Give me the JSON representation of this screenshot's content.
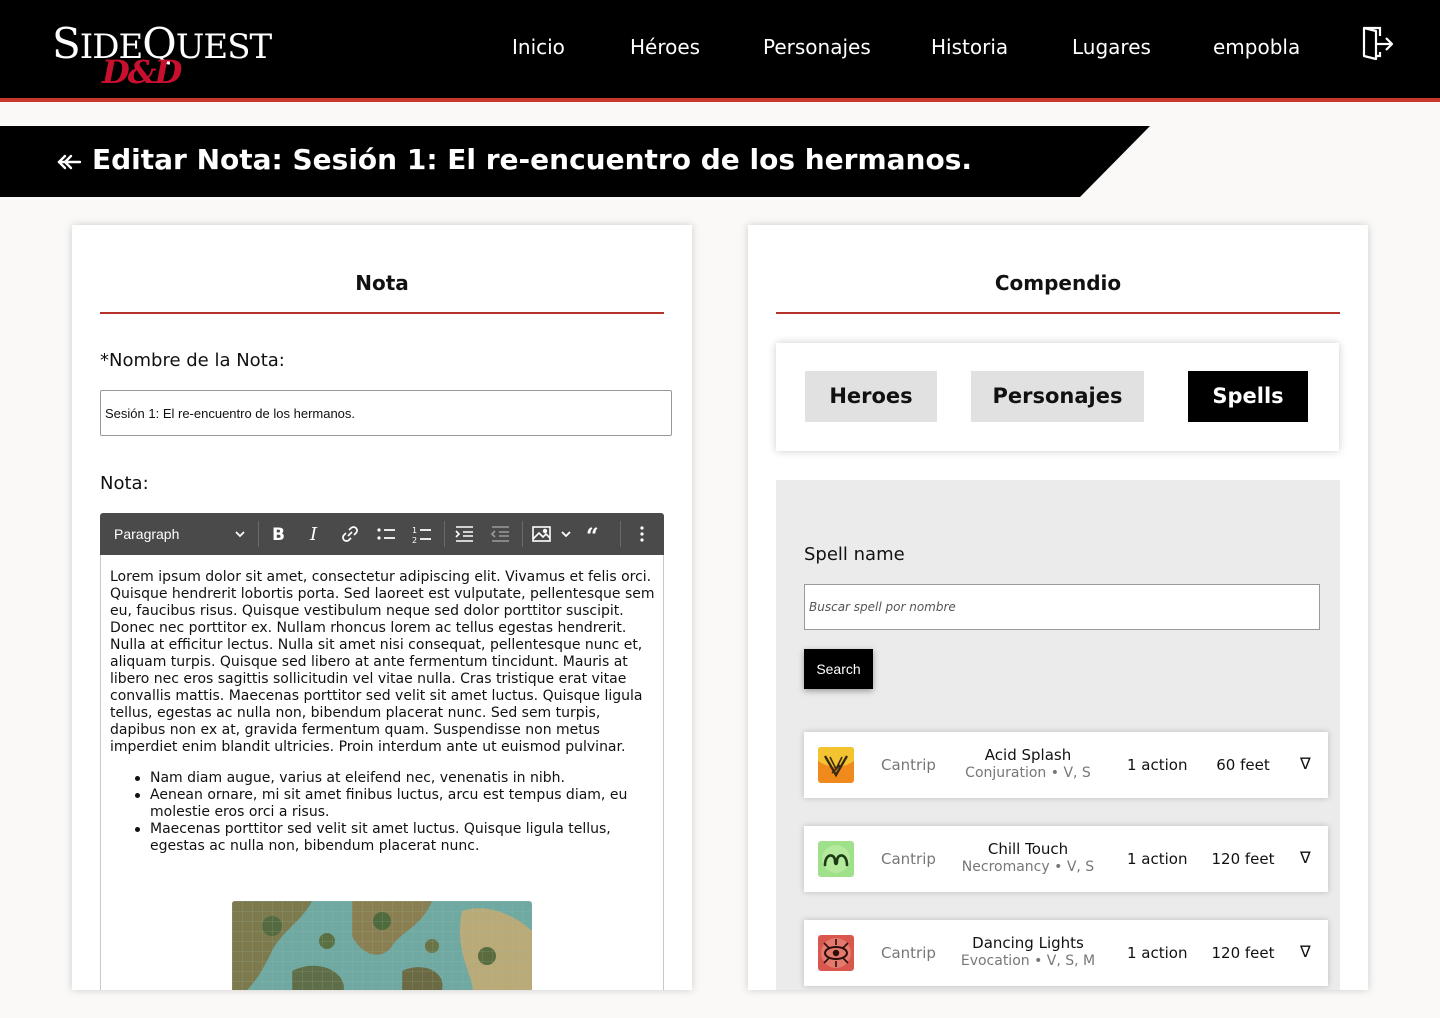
{
  "brand": {
    "name_main": "SideQuest",
    "name_sub": "D&D",
    "accent_red": "#c8392b",
    "logo_red": "#c8102e"
  },
  "nav": {
    "items": [
      "Inicio",
      "Héroes",
      "Personajes",
      "Historia",
      "Lugares",
      "empobla"
    ],
    "logout_icon": "logout-icon"
  },
  "page": {
    "title": "Editar Nota: Sesión 1: El re-encuentro de los hermanos.",
    "back_icon": "back-arrow-icon"
  },
  "nota": {
    "heading": "Nota",
    "name_label": "*Nombre de la Nota:",
    "name_value": "Sesión 1: El re-encuentro de los hermanos.",
    "note_label": "Nota:",
    "editor": {
      "block_style": "Paragraph",
      "toolbar_icons": [
        "chevron-down-icon",
        "bold-icon",
        "italic-icon",
        "link-icon",
        "bulleted-list-icon",
        "numbered-list-icon",
        "indent-icon",
        "outdent-icon",
        "image-icon",
        "quote-icon",
        "more-icon"
      ],
      "paragraph": "Lorem ipsum dolor sit amet, consectetur adipiscing elit. Vivamus et felis orci. Quisque hendrerit lobortis porta. Sed laoreet est vulputate, pellentesque sem eu, faucibus risus. Quisque vestibulum neque sed dolor porttitor suscipit. Donec nec porttitor ex. Nullam rhoncus lorem ac tellus egestas hendrerit. Nulla at efficitur lectus. Nulla sit amet nisi consequat, pellentesque nunc et, aliquam turpis. Quisque sed libero at ante fermentum tincidunt. Mauris at libero nec eros sagittis sollicitudin vel vitae nulla. Cras tristique erat vitae convallis mattis. Maecenas porttitor sed velit sit amet luctus. Quisque ligula tellus, egestas ac nulla non, bibendum placerat nunc. Sed sem turpis, dapibus non ex at, gravida fermentum quam. Suspendisse non metus imperdiet enim blandit ultricies. Proin interdum ante ut euismod pulvinar.",
      "bullets": [
        "Nam diam augue, varius at eleifend nec, venenatis in nibh.",
        "Aenean ornare, mi sit amet finibus luctus, arcu est tempus diam, eu molestie eros orci a risus.",
        "Maecenas porttitor sed velit sit amet luctus. Quisque ligula tellus, egestas ac nulla non, bibendum placerat nunc."
      ]
    }
  },
  "compendio": {
    "heading": "Compendio",
    "tabs": [
      "Heroes",
      "Personajes",
      "Spells"
    ],
    "active_tab": "Spells",
    "search": {
      "label": "Spell name",
      "placeholder": "Buscar spell por nombre",
      "button": "Search"
    },
    "spells": [
      {
        "icon": "acid-splash-icon",
        "level": "Cantrip",
        "name": "Acid Splash",
        "school": "Conjuration • V, S",
        "casting_time": "1 action",
        "range": "60 feet",
        "toggle": "∇"
      },
      {
        "icon": "chill-touch-icon",
        "level": "Cantrip",
        "name": "Chill Touch",
        "school": "Necromancy • V, S",
        "casting_time": "1 action",
        "range": "120 feet",
        "toggle": "∇"
      },
      {
        "icon": "dancing-lights-icon",
        "level": "Cantrip",
        "name": "Dancing Lights",
        "school": "Evocation • V, S, M",
        "casting_time": "1 action",
        "range": "120 feet",
        "toggle": "∇"
      }
    ]
  }
}
